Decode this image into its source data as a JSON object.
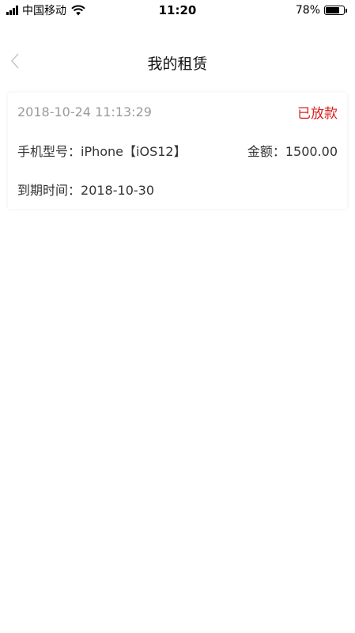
{
  "status_bar": {
    "carrier": "中国移动",
    "time": "11:20",
    "battery_percent": "78%",
    "battery_level": 0.78
  },
  "nav": {
    "title": "我的租赁"
  },
  "rental": {
    "datetime": "2018-10-24 11:13:29",
    "status": "已放款",
    "status_color": "#d81e1e",
    "model_label": "手机型号：",
    "model_value": "iPhone【iOS12】",
    "amount_label": "金额：",
    "amount_value": "1500.00",
    "due_label": "到期时间：",
    "due_value": "2018-10-30"
  },
  "icons": {
    "back": "chevron-left-icon",
    "wifi": "wifi-icon",
    "signal": "signal-icon",
    "battery": "battery-icon"
  }
}
